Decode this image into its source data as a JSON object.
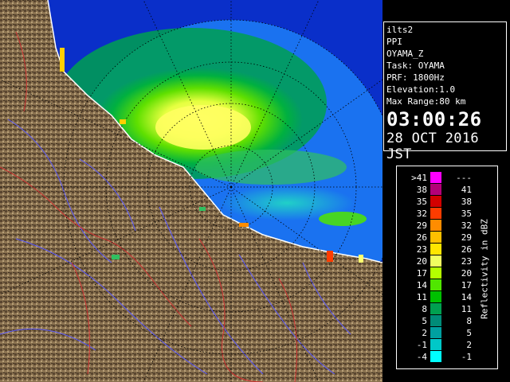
{
  "info": {
    "product": "ilts2",
    "mode": "PPI",
    "site": "OYAMA_Z",
    "task": "Task: OYAMA",
    "prf": "PRF: 1800Hz",
    "elevation": "Elevation:1.0",
    "max_range": "Max Range:80 km",
    "time": "03:00:26",
    "date": "28 OCT 2016 JST"
  },
  "legend": {
    "title": "Reflectivity in dBZ",
    "rows": [
      {
        "lo": ">41",
        "hi": "---",
        "color": "#ff00ff"
      },
      {
        "lo": "38",
        "hi": "41",
        "color": "#b40078"
      },
      {
        "lo": "35",
        "hi": "38",
        "color": "#d20000"
      },
      {
        "lo": "32",
        "hi": "35",
        "color": "#ff3c00"
      },
      {
        "lo": "29",
        "hi": "32",
        "color": "#ff8c00"
      },
      {
        "lo": "26",
        "hi": "29",
        "color": "#ffc000"
      },
      {
        "lo": "23",
        "hi": "26",
        "color": "#ffe600"
      },
      {
        "lo": "20",
        "hi": "23",
        "color": "#f0ff60"
      },
      {
        "lo": "17",
        "hi": "20",
        "color": "#b4ff00"
      },
      {
        "lo": "14",
        "hi": "17",
        "color": "#50e600"
      },
      {
        "lo": "11",
        "hi": "14",
        "color": "#00c000"
      },
      {
        "lo": "8",
        "hi": "11",
        "color": "#00a050"
      },
      {
        "lo": "5",
        "hi": "8",
        "color": "#008c78"
      },
      {
        "lo": "2",
        "hi": "5",
        "color": "#00a0a0"
      },
      {
        "lo": "-1",
        "hi": "2",
        "color": "#00c8c8"
      },
      {
        "lo": "-4",
        "hi": "-1",
        "color": "#00ffff"
      }
    ]
  },
  "colors": {
    "sea": "#0a2fc9",
    "coverage": "#1a72f0",
    "land": "#8a7250",
    "rivers": "#5a5aff",
    "borders": "#cc3030",
    "coast": "#ffffff"
  }
}
